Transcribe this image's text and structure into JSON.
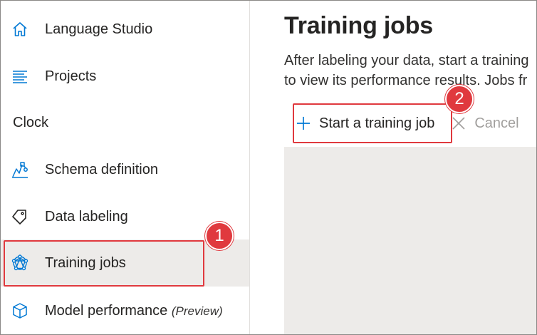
{
  "sidebar": {
    "items": [
      {
        "label": "Language Studio",
        "icon": "home-icon"
      },
      {
        "label": "Projects",
        "icon": "list-icon"
      },
      {
        "label": "Schema definition",
        "icon": "schema-icon"
      },
      {
        "label": "Data labeling",
        "icon": "tag-icon"
      },
      {
        "label": "Training jobs",
        "icon": "network-icon",
        "selected": true
      },
      {
        "label": "Model performance",
        "suffix": "(Preview)",
        "icon": "cube-icon"
      }
    ],
    "project_name": "Clock"
  },
  "main": {
    "title": "Training jobs",
    "description_line1": "After labeling your data, start a training",
    "description_line2": "to view its performance results. Jobs fr",
    "toolbar": {
      "start_label": "Start a training job",
      "cancel_label": "Cancel"
    }
  },
  "callouts": {
    "one": "1",
    "two": "2"
  },
  "colors": {
    "accent": "#0078d4",
    "callout": "#e0393e",
    "selected_bg": "#edebe9"
  }
}
